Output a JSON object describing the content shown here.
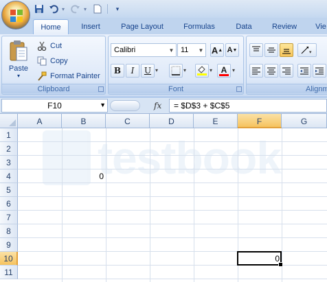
{
  "quick_access": {
    "icons": [
      "save-icon",
      "undo-icon",
      "redo-icon",
      "new-document-icon",
      "customize-icon"
    ]
  },
  "tabs": [
    {
      "label": "Home",
      "active": true
    },
    {
      "label": "Insert"
    },
    {
      "label": "Page Layout"
    },
    {
      "label": "Formulas"
    },
    {
      "label": "Data"
    },
    {
      "label": "Review"
    },
    {
      "label": "Vie"
    }
  ],
  "clipboard": {
    "paste_label": "Paste",
    "cut_label": "Cut",
    "copy_label": "Copy",
    "format_painter_label": "Format Painter",
    "group_label": "Clipboard"
  },
  "font": {
    "family": "Calibri",
    "size": "11",
    "grow_label": "A",
    "shrink_label": "A",
    "bold_label": "B",
    "italic_label": "I",
    "underline_label": "U",
    "font_color_label": "A",
    "group_label": "Font",
    "fill_color": "#ffff00",
    "font_color": "#ff0000"
  },
  "alignment": {
    "group_label": "Alignm"
  },
  "formula_bar": {
    "name_box": "F10",
    "fx_label": "fx",
    "formula": "= $D$3 + $C$5"
  },
  "sheet": {
    "columns": [
      "A",
      "B",
      "C",
      "D",
      "E",
      "F",
      "G"
    ],
    "rows": [
      "1",
      "2",
      "3",
      "4",
      "5",
      "6",
      "7",
      "8",
      "9",
      "10",
      "11"
    ],
    "selected_column": "F",
    "selected_row": "10",
    "cells": {
      "B4": "0",
      "F10": "0"
    }
  },
  "watermark": {
    "text": "testbook"
  }
}
